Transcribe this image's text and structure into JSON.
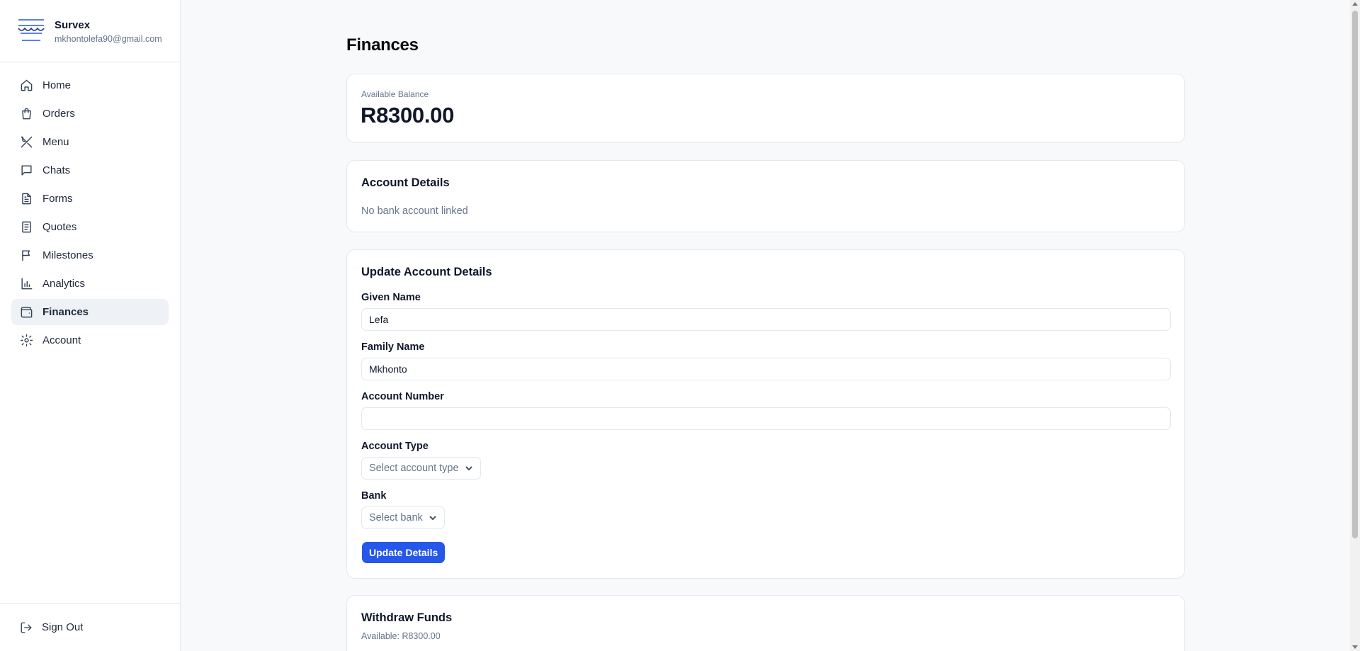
{
  "brand": {
    "name": "Survex",
    "email": "mkhontolefa90@gmail.com",
    "logo_color": "#2557e8"
  },
  "sidebar": {
    "items": [
      {
        "label": "Home",
        "icon": "home-icon",
        "active": false
      },
      {
        "label": "Orders",
        "icon": "shopping-bag-icon",
        "active": false
      },
      {
        "label": "Menu",
        "icon": "utensils-icon",
        "active": false
      },
      {
        "label": "Chats",
        "icon": "chat-icon",
        "active": false
      },
      {
        "label": "Forms",
        "icon": "file-text-icon",
        "active": false
      },
      {
        "label": "Quotes",
        "icon": "receipt-icon",
        "active": false
      },
      {
        "label": "Milestones",
        "icon": "flag-icon",
        "active": false
      },
      {
        "label": "Analytics",
        "icon": "bar-chart-icon",
        "active": false
      },
      {
        "label": "Finances",
        "icon": "wallet-icon",
        "active": true
      },
      {
        "label": "Account",
        "icon": "gear-icon",
        "active": false
      }
    ],
    "signout_label": "Sign Out"
  },
  "page": {
    "title": "Finances"
  },
  "balance": {
    "label": "Available Balance",
    "value": "R8300.00"
  },
  "account_details": {
    "title": "Account Details",
    "status_text": "No bank account linked"
  },
  "update_form": {
    "title": "Update Account Details",
    "given_name_label": "Given Name",
    "given_name_value": "Lefa",
    "family_name_label": "Family Name",
    "family_name_value": "Mkhonto",
    "account_number_label": "Account Number",
    "account_number_value": "",
    "account_type_label": "Account Type",
    "account_type_placeholder": "Select account type",
    "bank_label": "Bank",
    "bank_placeholder": "Select bank",
    "submit_label": "Update Details",
    "accent_color": "#2557e8"
  },
  "withdraw": {
    "title": "Withdraw Funds",
    "available_text": "Available: R8300.00"
  }
}
